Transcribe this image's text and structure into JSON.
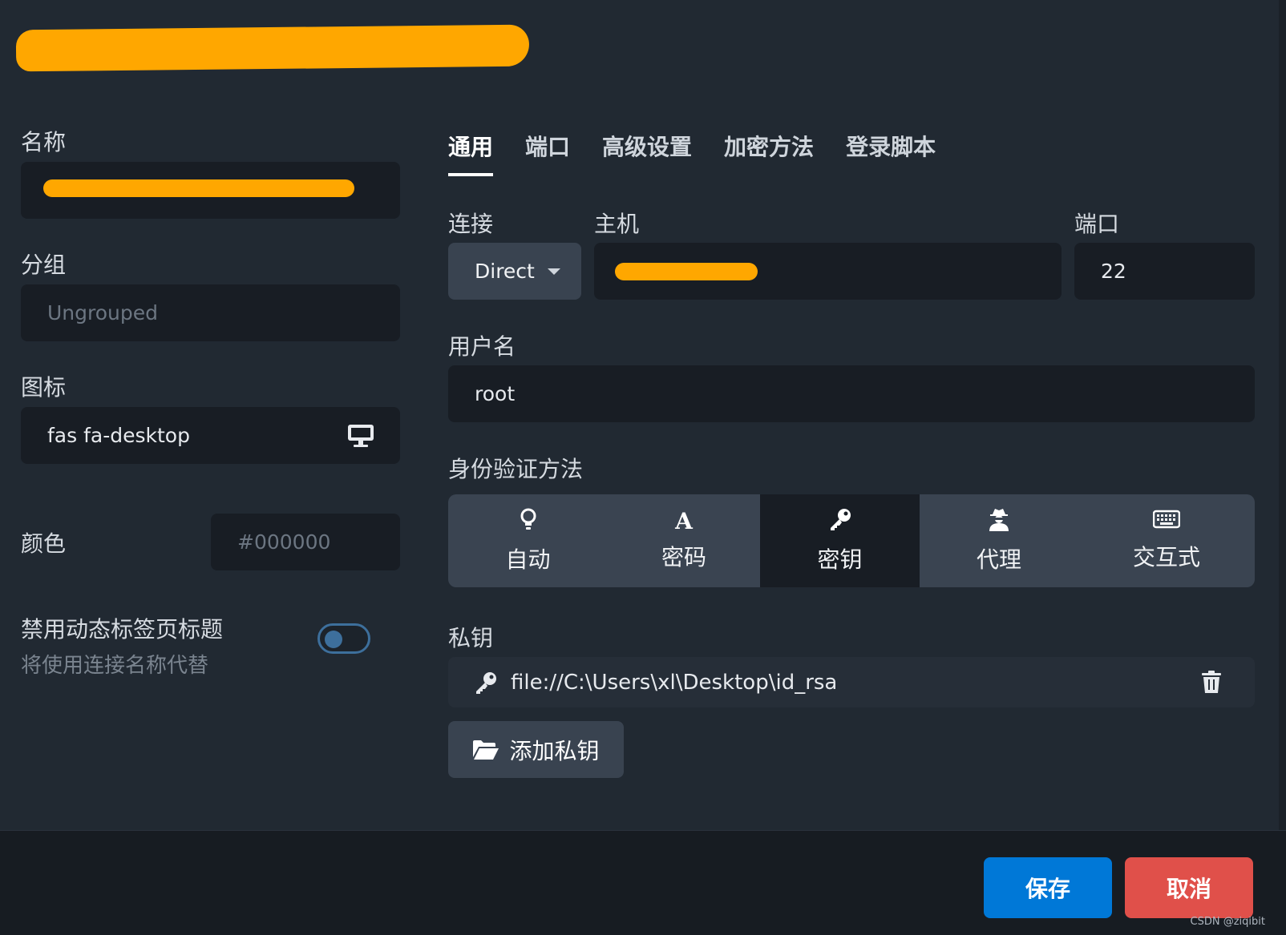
{
  "left": {
    "name_label": "名称",
    "group_label": "分组",
    "group_placeholder": "Ungrouped",
    "icon_label": "图标",
    "icon_value": "fas fa-desktop",
    "color_label": "颜色",
    "color_placeholder": "#000000",
    "disable_title_label": "禁用动态标签页标题",
    "disable_title_hint": "将使用连接名称代替"
  },
  "tabs": [
    {
      "label": "通用",
      "active": true
    },
    {
      "label": "端口"
    },
    {
      "label": "高级设置"
    },
    {
      "label": "加密方法"
    },
    {
      "label": "登录脚本"
    }
  ],
  "general": {
    "connection_label": "连接",
    "connection_value": "Direct",
    "host_label": "主机",
    "port_label": "端口",
    "port_value": "22",
    "username_label": "用户名",
    "username_value": "root",
    "auth_label": "身份验证方法",
    "auth_options": [
      {
        "label": "自动",
        "icon": "lightbulb-icon"
      },
      {
        "label": "密码",
        "icon": "font-icon"
      },
      {
        "label": "密钥",
        "icon": "key-icon",
        "selected": true
      },
      {
        "label": "代理",
        "icon": "user-secret-icon"
      },
      {
        "label": "交互式",
        "icon": "keyboard-icon"
      }
    ],
    "private_key_label": "私钥",
    "private_key_path": "file://C:\\Users\\xl\\Desktop\\id_rsa",
    "add_key_label": "添加私钥"
  },
  "footer": {
    "save_label": "保存",
    "cancel_label": "取消"
  },
  "watermark": "CSDN @ziqibit",
  "colors": {
    "background": "#212932",
    "field": "#181d24",
    "accent_save": "#0078d7",
    "accent_cancel": "#e0504a",
    "redaction": "#ffa700"
  }
}
